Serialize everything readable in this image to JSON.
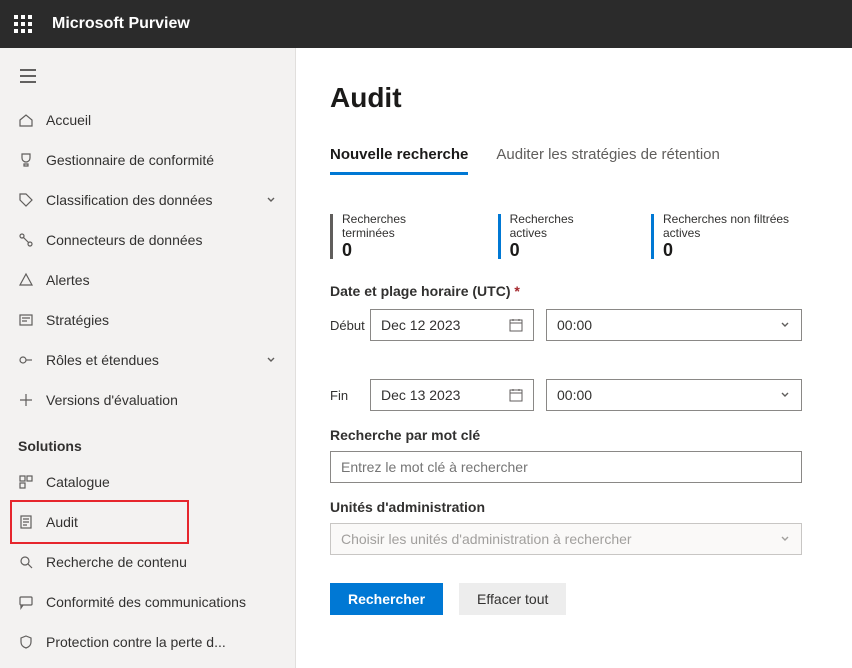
{
  "brand": "Microsoft Purview",
  "nav": {
    "items": [
      {
        "label": "Accueil"
      },
      {
        "label": "Gestionnaire de conformité"
      },
      {
        "label": "Classification des données",
        "expandable": true
      },
      {
        "label": "Connecteurs de données"
      },
      {
        "label": "Alertes"
      },
      {
        "label": "Stratégies"
      },
      {
        "label": "Rôles et étendues",
        "expandable": true
      },
      {
        "label": "Versions d'évaluation"
      }
    ],
    "section_label": "Solutions",
    "solutions": [
      {
        "label": "Catalogue"
      },
      {
        "label": "Audit"
      },
      {
        "label": "Recherche de contenu"
      },
      {
        "label": "Conformité des communications"
      },
      {
        "label": "Protection contre la perte d..."
      }
    ]
  },
  "page": {
    "title": "Audit",
    "tabs": [
      {
        "label": "Nouvelle recherche",
        "active": true
      },
      {
        "label": "Auditer les stratégies de rétention"
      }
    ],
    "stats": [
      {
        "label": "Recherches terminées",
        "value": "0"
      },
      {
        "label": "Recherches actives",
        "value": "0"
      },
      {
        "label": "Recherches non filtrées actives",
        "value": "0"
      }
    ],
    "datetime_title": "Date et plage horaire (UTC)",
    "required_mark": "*",
    "start_label": "Début",
    "start_date": "Dec 12 2023",
    "start_time": "00:00",
    "end_label": "Fin",
    "end_date": "Dec 13 2023",
    "end_time": "00:00",
    "keyword_label": "Recherche par mot clé",
    "keyword_placeholder": "Entrez le mot clé à rechercher",
    "admin_units_label": "Unités d'administration",
    "admin_units_placeholder": "Choisir les unités d'administration à rechercher",
    "search_btn": "Rechercher",
    "clear_btn": "Effacer tout"
  }
}
